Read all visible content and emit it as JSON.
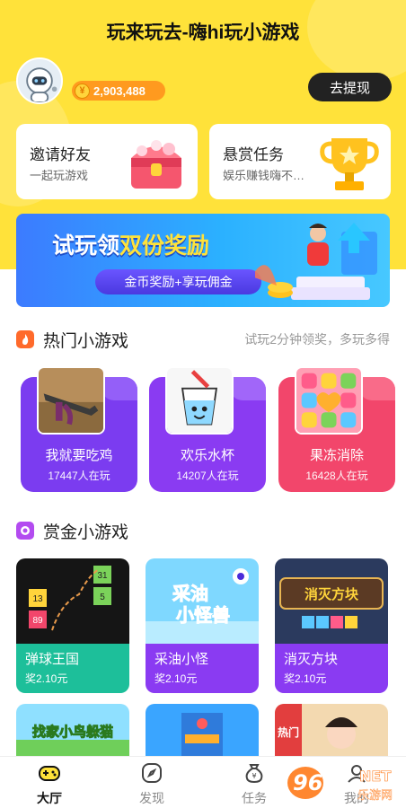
{
  "app": {
    "title": "玩来玩去-嗨hi玩小游戏"
  },
  "user": {
    "coin_symbol": "¥",
    "coins": "2,903,488"
  },
  "header": {
    "withdraw_label": "去提现"
  },
  "tasks": [
    {
      "title": "邀请好友",
      "subtitle": "一起玩游戏"
    },
    {
      "title": "悬赏任务",
      "subtitle": "娱乐赚钱嗨不…"
    }
  ],
  "banner": {
    "title_pre": "试玩领",
    "title_highlight": "双份奖励",
    "pill": "金币奖励+享玩佣金"
  },
  "hot_section": {
    "title": "热门小游戏",
    "hint": "试玩2分钟领奖，多玩多得",
    "games": [
      {
        "name": "我就要吃鸡",
        "players": "17447人在玩",
        "color": "#7B3CF0"
      },
      {
        "name": "欢乐水杯",
        "players": "14207人在玩",
        "color": "#8A3BF2"
      },
      {
        "name": "果冻消除",
        "players": "16428人在玩",
        "color": "#F2466B"
      }
    ]
  },
  "bounty_section": {
    "title": "赏金小游戏",
    "games": [
      {
        "name": "弹球王国",
        "reward": "奖2.10元",
        "color": "#1DBF9A"
      },
      {
        "name": "采油小怪",
        "reward": "奖2.10元",
        "color": "#8A3BF2"
      },
      {
        "name": "消灭方块",
        "reward": "奖2.10元",
        "color": "#8A3BF2"
      }
    ],
    "more_art_texts": [
      "找家小鸟躲猫",
      "热门"
    ]
  },
  "tabbar": {
    "items": [
      {
        "label": "大厅",
        "icon": "gamepad-icon",
        "active": true
      },
      {
        "label": "发现",
        "icon": "compass-icon",
        "active": false
      },
      {
        "label": "任务",
        "icon": "moneybag-icon",
        "active": false
      },
      {
        "label": "我的",
        "icon": "user-icon",
        "active": false
      }
    ]
  },
  "watermark": {
    "text_main": "962",
    "text_net": "NET",
    "text_sub": "乐游网"
  },
  "colors": {
    "brand_yellow": "#FFE23A",
    "coin_orange": "#FF9A1F",
    "dark_button": "#222222"
  }
}
